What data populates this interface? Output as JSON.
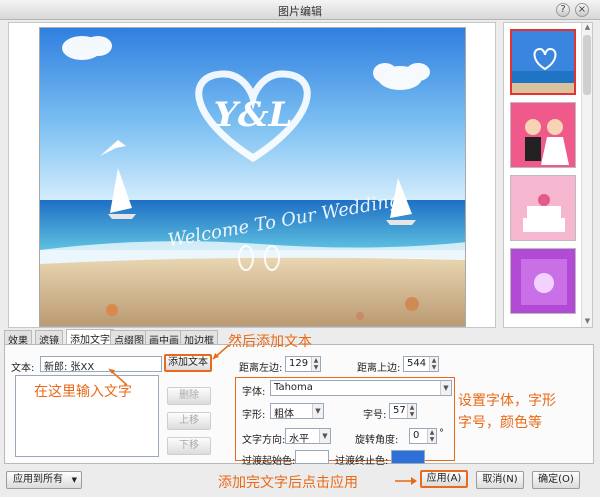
{
  "window": {
    "title": "图片编辑",
    "help_glyph": "?",
    "close_glyph": "×"
  },
  "photo": {
    "monogram": "Y&L",
    "banner": "Welcome To Our Wedding"
  },
  "thumbnails": [
    {
      "name": "beach-heart",
      "selected": true
    },
    {
      "name": "couple-cartoon",
      "selected": false
    },
    {
      "name": "wedding-cake",
      "selected": false
    },
    {
      "name": "purple-hall",
      "selected": false
    }
  ],
  "tabs": [
    "效果",
    "滤镜",
    "添加文字",
    "点缀图",
    "画中画",
    "加边框"
  ],
  "active_tab": "添加文字",
  "form": {
    "text_label": "文本:",
    "text_value": "新郎: 张XX",
    "add_text_button": "添加文本",
    "delete_button": "删除",
    "up_button": "上移",
    "down_button": "下移",
    "left_label": "距离左边:",
    "left_value": "129",
    "top_label": "距离上边:",
    "top_value": "544",
    "font_label": "字体:",
    "font_value": "Tahoma",
    "style_label": "字形:",
    "style_value": "粗体",
    "size_label": "字号:",
    "size_value": "57",
    "direction_label": "文字方向:",
    "direction_value": "水平",
    "rotate_label": "旋转角度:",
    "rotate_value": "0",
    "rotate_unit": "°",
    "grad_start_label": "过渡起始色:",
    "grad_end_label": "过渡终止色:",
    "grad_end_color": "#2f6fd8"
  },
  "footer": {
    "apply_all": "应用到所有",
    "apply": "应用(A)",
    "cancel": "取消(N)",
    "ok": "确定(O)"
  },
  "annotations": {
    "then_add": "然后添加文本",
    "input_here": "在这里输入文字",
    "set_font": "设置字体，字形",
    "set_font2": "字号，颜色等",
    "click_apply": "添加完文字后点击应用"
  },
  "colors": {
    "annotation": "#e86a18",
    "selected_thumb": "#e53333"
  }
}
